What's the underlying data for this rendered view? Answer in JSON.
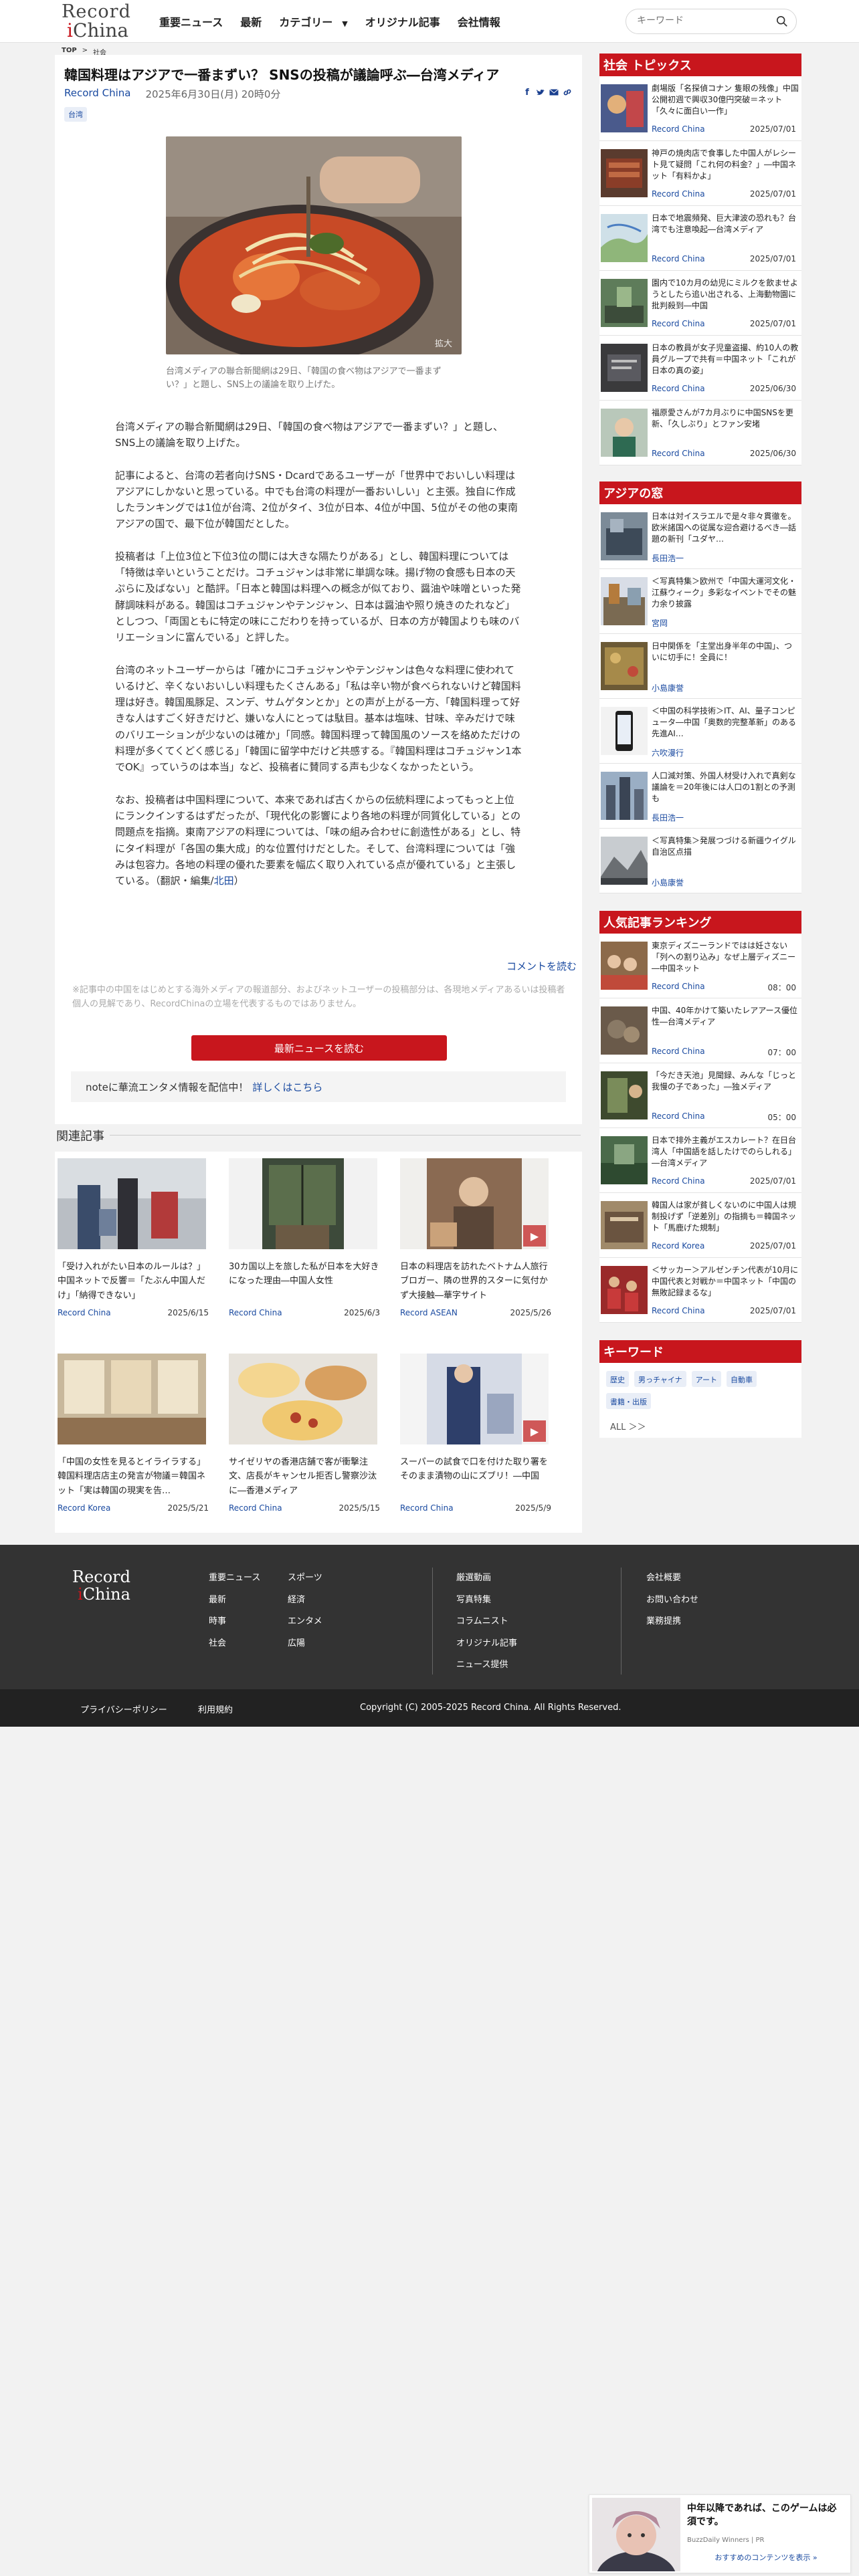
{
  "header": {
    "logo": {
      "line1": "Record",
      "line2_mark": "i",
      "line2_text": "China"
    },
    "nav": [
      "重要ニュース",
      "最新",
      "カテゴリー",
      "オリジナル記事",
      "会社情報"
    ],
    "search_placeholder": "キーワード"
  },
  "breadcrumb": {
    "home": "TOP",
    "sep": ">",
    "current": "社会"
  },
  "article": {
    "title": "韓国料理はアジアで一番まずい？ SNSの投稿が議論呼ぶ―台湾メディア",
    "source": "Record China",
    "date": "2025年6月30日(月) 20時0分",
    "tag": "台湾",
    "photo_zoom": "拡大",
    "caption": "台湾メディアの聯合新聞網は29日、「韓国の食べ物はアジアで一番まずい？」と題し、SNS上の議論を取り上げた。",
    "paragraphs": [
      "台湾メディアの聯合新聞網は29日、「韓国の食べ物はアジアで一番まずい？」と題し、SNS上の議論を取り上げた。",
      "記事によると、台湾の若者向けSNS・Dcardであるユーザーが「世界中でおいしい料理はアジアにしかないと思っている。中でも台湾の料理が一番おいしい」と主張。独自に作成したランキングでは1位が台湾、2位がタイ、3位が日本、4位が中国、5位がその他の東南アジアの国で、最下位が韓国だとした。",
      "投稿者は「上位3位と下位3位の間には大きな隔たりがある」とし、韓国料理については「特徴は辛いということだけ。コチュジャンは非常に単調な味。揚げ物の食感も日本の天ぷらに及ばない」と酷評。「日本と韓国は料理への概念が似ており、醤油や味噌といった発酵調味料がある。韓国はコチュジャンやテンジャン、日本は醤油や照り焼きのたれなど」としつつ、「両国ともに特定の味にこだわりを持っているが、日本の方が韓国よりも味のバリエーションに富んでいる」と評した。",
      "台湾のネットユーザーからは「確かにコチュジャンやテンジャンは色々な料理に使われているけど、辛くないおいしい料理もたくさんある」「私は辛い物が食べられないけど韓国料理は好き。韓国風豚足、スンデ、サムゲタンとか」との声が上がる一方、「韓国料理って好きな人はすごく好きだけど、嫌いな人にとっては駄目。基本は塩味、甘味、辛みだけで味のバリエーションが少ないのは確か」「同感。韓国料理って韓国風のソースを絡めただけの料理が多くてくどく感じる」「韓国に留学中だけど共感する。『韓国料理はコチュジャン1本でOK』っていうのは本当」など、投稿者に賛同する声も少なくなかったという。",
      "なお、投稿者は中国料理について、本来であれば古くからの伝統料理によってもっと上位にランクインするはずだったが、「現代化の影響により各地の料理が同質化している」との問題点を指摘。東南アジアの料理については、「味の組み合わせに創造性がある」とし、特にタイ料理が「各国の集大成」的な位置付けだとした。そして、台湾料理については「強みは包容力。各地の料理の優れた要素を幅広く取り入れている点が優れている」と主張している。"
    ],
    "credit_prefix": "（翻訳・編集/",
    "credit_editor": "北田",
    "credit_suffix": "）",
    "comment_link": "コメントを読む",
    "disclaimer": "※記事中の中国をはじめとする海外メディアの報道部分、およびネットユーザーの投稿部分は、各現地メディアあるいは投稿者個人の見解であり、RecordChinaの立場を代表するものではありません。",
    "latest_button": "最新ニュースを読む",
    "note_text": "noteに華流エンタメ情報を配信中！",
    "note_link": "詳しくはこちら"
  },
  "related": {
    "heading": "関連記事",
    "items": [
      {
        "title": "「受け入れがたい日本のルールは？」中国ネットで反響＝「たぶん中国人だけ」「納得できない」",
        "source": "Record China",
        "date": "2025/6/15"
      },
      {
        "title": "30カ国以上を旅した私が日本を大好きになった理由―中国人女性",
        "source": "Record China",
        "date": "2025/6/3"
      },
      {
        "title": "日本の料理店を訪れたベトナム人旅行ブロガー、隣の世界的スターに気付かず大接触―華字サイト",
        "source": "Record ASEAN",
        "date": "2025/5/26"
      },
      {
        "title": "「中国の女性を見るとイライラする」韓国料理店店主の発言が物議＝韓国ネット「実は韓国の現実を告…",
        "source": "Record Korea",
        "date": "2025/5/21"
      },
      {
        "title": "サイゼリヤの香港店舗で客が衝撃注文、店長がキャンセル拒否し警察沙汰に―香港メディア",
        "source": "Record China",
        "date": "2025/5/15"
      },
      {
        "title": "スーパーの試食で口を付けた取り署をそのまま漬物の山にズブリ！―中国",
        "source": "Record China",
        "date": "2025/5/9"
      }
    ]
  },
  "sidebar": {
    "social": {
      "heading": "社会 トピックス",
      "items": [
        {
          "title": "劇場版「名探偵コナン 隻眼の残像」中国公開初週で興収30億円突破＝ネット「久々に面白い一作」",
          "source": "Record China",
          "date": "2025/07/01"
        },
        {
          "title": "神戸の焼肉店で食事した中国人がレシート見て疑問「これ何の料金？」―中国ネット「有料かよ」",
          "source": "Record China",
          "date": "2025/07/01"
        },
        {
          "title": "日本で地震頻発、巨大津波の恐れも？台湾でも注意喚起―台湾メディア",
          "source": "Record China",
          "date": "2025/07/01"
        },
        {
          "title": "園内で10カ月の幼児にミルクを飲ませようとしたら追い出される、上海動物園に批判殺到―中国",
          "source": "Record China",
          "date": "2025/07/01"
        },
        {
          "title": "日本の教員が女子児童盗撮、約10人の教員グループで共有＝中国ネット「これが日本の真の姿」",
          "source": "Record China",
          "date": "2025/06/30"
        },
        {
          "title": "福原愛さんが7カ月ぶりに中国SNSを更新、「久しぶり」とファン安堵",
          "source": "Record China",
          "date": "2025/06/30"
        }
      ]
    },
    "asia": {
      "heading": "アジアの窓",
      "items": [
        {
          "title": "日本は対イスラエルで是々非々貫徹を。欧米諸国への従属な迎合避けるべき―話題の新刊「ユダヤ…",
          "source": "長田浩一"
        },
        {
          "title": "＜写真特集＞欧州で「中国大運河文化・江蘇ウィーク」多彩なイベントでその魅力余り披露",
          "source": "宮岡"
        },
        {
          "title": "日中関係を「主堂出身半年の中国」、ついに切手に！全員に！",
          "source": "小島康誉"
        },
        {
          "title": "＜中国の科学技術＞IT、AI、量子コンピュータ―中国「奥数的完整革新」のある先進AI…",
          "source": "六吹漫行"
        },
        {
          "title": "人口減対策、外国人材受け入れで真剣な議論を＝20年後には人口の1割との予測も",
          "source": "長田浩一"
        },
        {
          "title": "＜写真特集＞発展つづける新疆ウイグル自治区点描",
          "source": "小島康誉"
        }
      ]
    },
    "ranking": {
      "heading": "人気記事ランキング",
      "items": [
        {
          "title": "東京ディズニーランドではは妊さない「列への割り込み」なぜ上層ディズニー―中国ネット",
          "source": "Record China",
          "date": "08：00"
        },
        {
          "title": "中国、40年かけて築いたレアアース優位性―台湾メディア",
          "source": "Record China",
          "date": "07：00"
        },
        {
          "title": "「今だき天池」見聞録、みんな「じっと我慢の子であった」―独メディア",
          "source": "Record China",
          "date": "05：00"
        },
        {
          "title": "日本で排外主義がエスカレート？在日台湾人「中国語を話したけでのらしれる」―台湾メディア",
          "source": "Record China",
          "date": "2025/07/01"
        },
        {
          "title": "韓国人は家が貧しくないのに中国人は規制投げず「逆差別」の指摘も＝韓国ネット「馬鹿げた規制」",
          "source": "Record Korea",
          "date": "2025/07/01"
        },
        {
          "title": "＜サッカー＞アルゼンチン代表が10月に中国代表と対戦か＝中国ネット「中国の無敗記録まるな」",
          "source": "Record China",
          "date": "2025/07/01"
        }
      ]
    },
    "keywords": {
      "heading": "キーワード",
      "items": [
        "歴史",
        "男っチャイナ",
        "アート",
        "自動車",
        "書籍・出版"
      ],
      "all_label": "ALL ＞＞"
    }
  },
  "footer": {
    "logo": {
      "line1": "Record",
      "line2_mark": "i",
      "line2_text": "China"
    },
    "col1": [
      "重要ニュース",
      "最新",
      "時事",
      "社会"
    ],
    "col2": [
      "スポーツ",
      "経済",
      "エンタメ",
      "広陽"
    ],
    "col3": [
      "厳選動画",
      "写真特集",
      "コラムニスト",
      "オリジナル記事",
      "ニュース提供"
    ],
    "col4": [
      "会社概要",
      "お問い合わせ",
      "業務提携"
    ],
    "privacy": "プライバシーポリシー",
    "terms": "利用規約",
    "copyright": "Copyright (C) 2005-2025 Record China. All Rights Reserved."
  },
  "ad": {
    "title": "中年以降であれば、このゲームは必須です。",
    "provider": "BuzzDaily Winners | PR",
    "button": "おすすめのコンテンツを表示 »"
  }
}
